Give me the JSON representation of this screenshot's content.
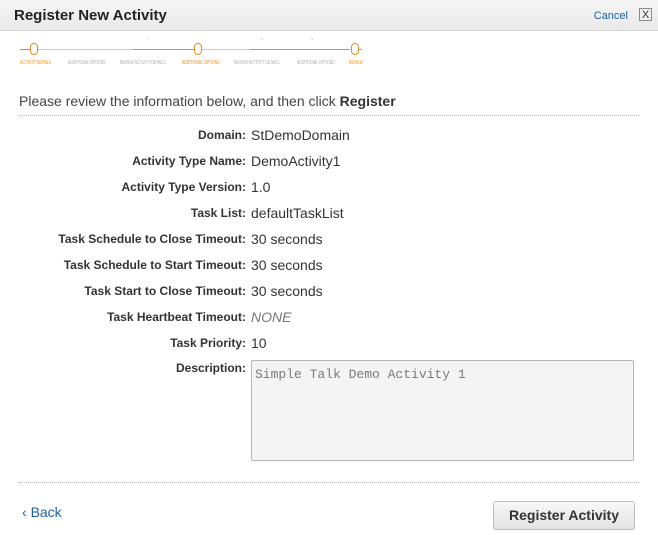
{
  "dialog": {
    "title": "Register New Activity",
    "cancel_label": "Cancel",
    "close_glyph": "X"
  },
  "wizard": {
    "steps": [
      {
        "label": "ACTIVITY DETAILS",
        "state": "done"
      },
      {
        "label": "ADDITIONAL OPTIONS",
        "state": "pending"
      },
      {
        "label": "REVIEW ACTIVITY DETAILS",
        "state": "pending"
      },
      {
        "label": "ADDITIONAL OPTIONS",
        "state": "active"
      },
      {
        "label": "REVIEW ACTIVITY DETAILS",
        "state": "pending"
      },
      {
        "label": "ADDITIONAL OPTIONS",
        "state": "pending"
      },
      {
        "label": "REVIEW",
        "state": "current"
      }
    ],
    "colors": {
      "active": "#e38f1f",
      "inactive": "#aaaaaa"
    }
  },
  "intro": {
    "text": "Please review the information below, and then click ",
    "emphasis": "Register"
  },
  "fields": [
    {
      "label": "Domain:",
      "value": "StDemoDomain"
    },
    {
      "label": "Activity Type Name:",
      "value": "DemoActivity1"
    },
    {
      "label": "Activity Type Version:",
      "value": "1.0"
    },
    {
      "label": "Task List:",
      "value": "defaultTaskList"
    },
    {
      "label": "Task Schedule to Close Timeout:",
      "value": "30 seconds"
    },
    {
      "label": "Task Schedule to Start Timeout:",
      "value": "30 seconds"
    },
    {
      "label": "Task Start to Close Timeout:",
      "value": "30 seconds"
    },
    {
      "label": "Task Heartbeat Timeout:",
      "value": "NONE"
    },
    {
      "label": "Task Priority:",
      "value": "10"
    }
  ],
  "description": {
    "label": "Description:",
    "value": "Simple Talk Demo Activity 1"
  },
  "footer": {
    "back_glyph": "‹",
    "back_label": "Back",
    "register_label": "Register Activity"
  }
}
